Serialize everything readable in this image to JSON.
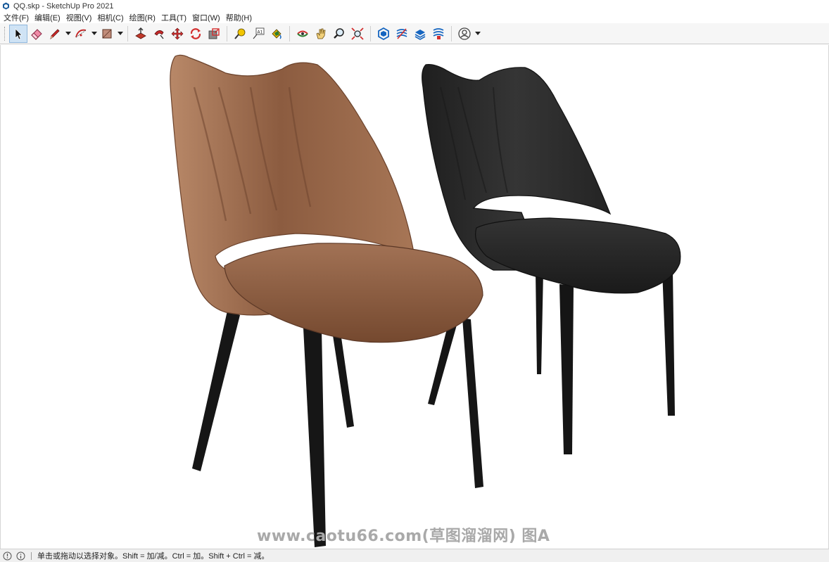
{
  "window": {
    "title": "QQ.skp - SketchUp Pro 2021",
    "app_icon": "sketchup-logo-icon"
  },
  "menu": {
    "items": [
      "文件(F)",
      "编辑(E)",
      "视图(V)",
      "相机(C)",
      "绘图(R)",
      "工具(T)",
      "窗口(W)",
      "帮助(H)"
    ]
  },
  "toolbar": {
    "tools": [
      {
        "name": "select-tool",
        "icon": "arrow-cursor-icon",
        "active": true
      },
      {
        "name": "eraser-tool",
        "icon": "eraser-icon"
      },
      {
        "name": "line-tool",
        "icon": "pencil-icon",
        "dropdown": true
      },
      {
        "name": "arc-tool",
        "icon": "arc-icon",
        "dropdown": true
      },
      {
        "name": "rectangle-tool",
        "icon": "rectangle-icon",
        "dropdown": true
      },
      {
        "name": "push-pull-tool",
        "icon": "push-pull-icon"
      },
      {
        "name": "follow-me-tool",
        "icon": "follow-me-icon"
      },
      {
        "name": "move-tool",
        "icon": "move-arrows-icon"
      },
      {
        "name": "rotate-tool",
        "icon": "rotate-icon"
      },
      {
        "name": "scale-tool",
        "icon": "scale-icon"
      },
      {
        "name": "tape-measure-tool",
        "icon": "tape-measure-icon"
      },
      {
        "name": "text-tool",
        "icon": "text-label-icon"
      },
      {
        "name": "paint-bucket-tool",
        "icon": "paint-bucket-icon"
      },
      {
        "name": "orbit-tool",
        "icon": "orbit-icon"
      },
      {
        "name": "pan-tool",
        "icon": "hand-icon"
      },
      {
        "name": "zoom-tool",
        "icon": "magnifier-icon"
      },
      {
        "name": "zoom-extents-tool",
        "icon": "zoom-extents-icon"
      },
      {
        "name": "3d-warehouse",
        "icon": "warehouse-icon"
      },
      {
        "name": "extension-warehouse",
        "icon": "extension-icon"
      },
      {
        "name": "layout-send",
        "icon": "layout-icon"
      },
      {
        "name": "extension-manager",
        "icon": "extension-manager-icon"
      },
      {
        "name": "account",
        "icon": "user-avatar-icon",
        "dropdown": true
      }
    ]
  },
  "viewport": {
    "watermark": "www.caotu66.com(草图溜溜网) 图A",
    "colors": {
      "brown_chair": "#9a6a4c",
      "brown_chair_shadow": "#6f4530",
      "brown_chair_highlight": "#b58466",
      "black_chair": "#262626",
      "black_chair_highlight": "#3c3c3c",
      "legs": "#161616"
    }
  },
  "status": {
    "text": "单击或拖动以选择对象。Shift = 加/减。Ctrl = 加。Shift + Ctrl = 减。",
    "icons": [
      "geo-location-icon",
      "info-icon"
    ]
  }
}
